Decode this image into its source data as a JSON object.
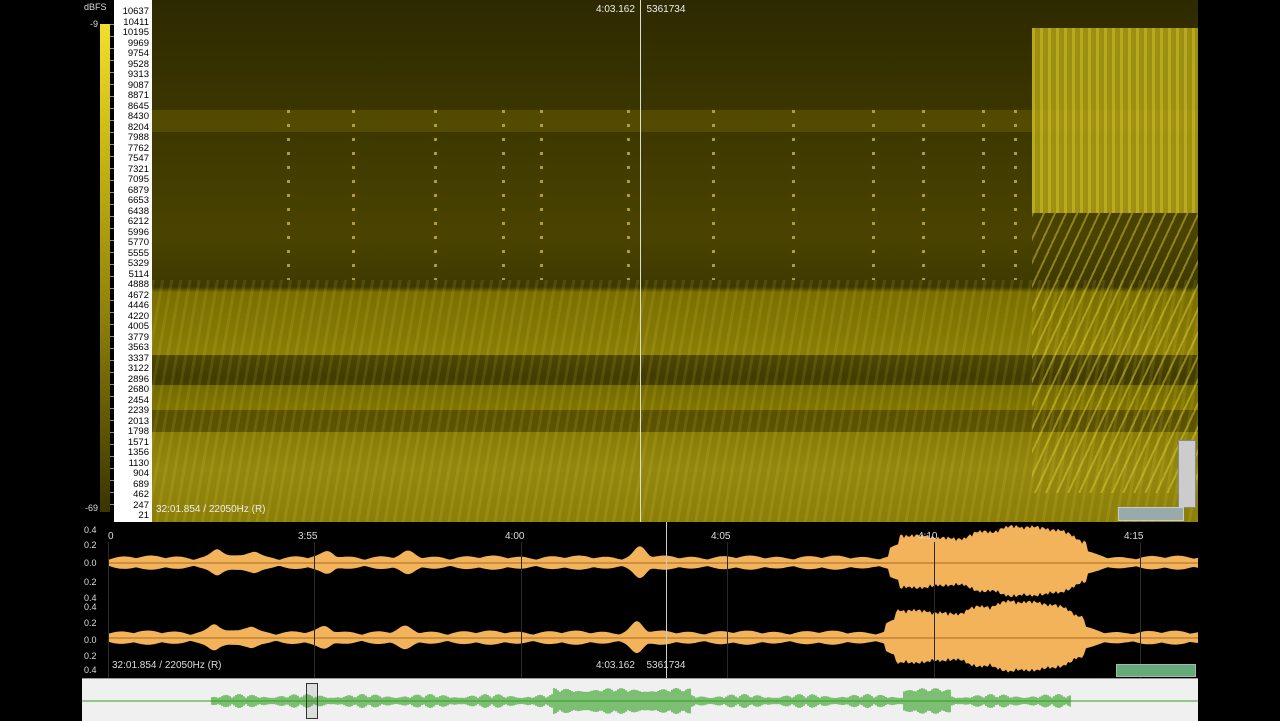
{
  "spectrogram": {
    "dbfs_label": "dBFS",
    "db_top": "-9",
    "db_bottom": "-69",
    "freq_ticks": [
      "10637",
      "10411",
      "10195",
      "9969",
      "9754",
      "9528",
      "9313",
      "9087",
      "8871",
      "8645",
      "8430",
      "8204",
      "7988",
      "7762",
      "7547",
      "7321",
      "7095",
      "6879",
      "6653",
      "6438",
      "6212",
      "5996",
      "5770",
      "5555",
      "5329",
      "5114",
      "4888",
      "4672",
      "4446",
      "4220",
      "4005",
      "3779",
      "3563",
      "3337",
      "3122",
      "2896",
      "2680",
      "2454",
      "2239",
      "2013",
      "1798",
      "1571",
      "1356",
      "1130",
      "904",
      "689",
      "462",
      "247",
      "21"
    ],
    "readout": "32:01.854 / 22050Hz (R)",
    "cursor_time": "4:03.162",
    "cursor_sample": "5361734"
  },
  "waveform": {
    "amp_labels": [
      "0.4",
      "0.2",
      "0.0",
      "0.2",
      "0.4",
      "0.4",
      "0.2",
      "0.0",
      "0.2",
      "0.4"
    ],
    "time_ticks": [
      "0",
      "3:55",
      "4:00",
      "4:05",
      "4:10",
      "4:15"
    ],
    "readout": "32:01.854 / 22050Hz (R)",
    "cursor_time": "4:03.162",
    "cursor_sample": "5361734"
  },
  "colors": {
    "spectrogram": "#8a7e08",
    "waveform": "#f2b35a",
    "overview_wave": "#2f9e1e"
  }
}
